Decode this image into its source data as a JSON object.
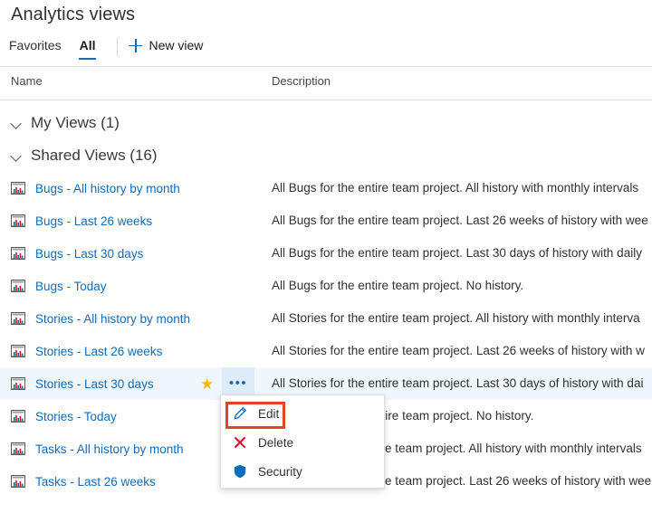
{
  "header": {
    "title": "Analytics views"
  },
  "tabs": [
    {
      "label": "Favorites",
      "active": false,
      "name": "tab-favorites"
    },
    {
      "label": "All",
      "active": true,
      "name": "tab-all"
    }
  ],
  "commands": {
    "new_view_label": "New view",
    "new_view_icon": "plus-icon"
  },
  "columns": {
    "name": "Name",
    "description": "Description"
  },
  "groups": [
    {
      "label": "My Views (1)",
      "expanded": true,
      "chevron": "chevron-down-icon",
      "rows": []
    },
    {
      "label": "Shared Views (16)",
      "expanded": true,
      "chevron": "chevron-down-icon",
      "rows": [
        {
          "name": "Bugs - All history by month",
          "description": "All Bugs for the entire team project. All history with monthly intervals",
          "icon": "chart-view-icon",
          "favorite": false,
          "selected": false
        },
        {
          "name": "Bugs - Last 26 weeks",
          "description": "All Bugs for the entire team project. Last 26 weeks of history with wee",
          "icon": "chart-view-icon",
          "favorite": false,
          "selected": false
        },
        {
          "name": "Bugs - Last 30 days",
          "description": "All Bugs for the entire team project. Last 30 days of history with daily",
          "icon": "chart-view-icon",
          "favorite": false,
          "selected": false
        },
        {
          "name": "Bugs - Today",
          "description": "All Bugs for the entire team project. No history.",
          "icon": "chart-view-icon",
          "favorite": false,
          "selected": false
        },
        {
          "name": "Stories - All history by month",
          "description": "All Stories for the entire team project. All history with monthly interva",
          "icon": "chart-view-icon",
          "favorite": false,
          "selected": false
        },
        {
          "name": "Stories - Last 26 weeks",
          "description": "All Stories for the entire team project. Last 26 weeks of history with w",
          "icon": "chart-view-icon",
          "favorite": false,
          "selected": false
        },
        {
          "name": "Stories - Last 30 days",
          "description": "All Stories for the entire team project. Last 30 days of history with dai",
          "icon": "chart-view-icon",
          "favorite": true,
          "selected": true
        },
        {
          "name": "Stories - Today",
          "description": "All Stories for the entire team project. No history.",
          "icon": "chart-view-icon",
          "favorite": false,
          "selected": false
        },
        {
          "name": "Tasks - All history by month",
          "description": "All Tasks for the entire team project. All history with monthly intervals",
          "icon": "chart-view-icon",
          "favorite": false,
          "selected": false
        },
        {
          "name": "Tasks - Last 26 weeks",
          "description": "All Tasks for the entire team project. Last 26 weeks of history with wee",
          "icon": "chart-view-icon",
          "favorite": false,
          "selected": false
        }
      ]
    }
  ],
  "context_menu": {
    "items": [
      {
        "label": "Edit",
        "icon": "pencil-icon",
        "highlighted": true
      },
      {
        "label": "Delete",
        "icon": "close-x-icon",
        "highlighted": false
      },
      {
        "label": "Security",
        "icon": "shield-icon",
        "highlighted": false
      }
    ]
  },
  "colors": {
    "link": "#0f6cbd",
    "accent": "#0f6cbd",
    "selected_row_bg": "#eff6fc",
    "ellipsis_bg": "#deecf9",
    "star": "#ffb900",
    "delete_x": "#e81123",
    "shield": "#0f6cbd",
    "highlight_border": "#e8402a",
    "text": "#323130"
  }
}
